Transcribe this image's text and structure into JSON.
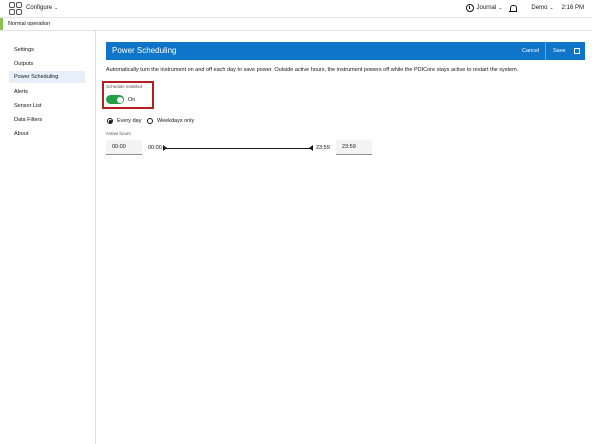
{
  "topbar": {
    "menu_label": "Configure",
    "journal_label": "Journal",
    "user_label": "Demo",
    "time": "2:16 PM"
  },
  "status": {
    "text": "Normal operation",
    "color": "#8bc34a"
  },
  "sidebar": {
    "items": [
      {
        "label": "Settings"
      },
      {
        "label": "Outputs"
      },
      {
        "label": "Power Scheduling",
        "active": true
      },
      {
        "label": "Alerts"
      },
      {
        "label": "Sensor List"
      },
      {
        "label": "Data Filters"
      },
      {
        "label": "About"
      }
    ]
  },
  "panel": {
    "title": "Power Scheduling",
    "cancel_label": "Cancel",
    "save_label": "Save",
    "header_color": "#0f75c9",
    "description": "Automatically turn the instrument on and off each day to save power. Outside active hours, the instrument powers off while the PDICore stays active to restart the system."
  },
  "schedule": {
    "toggle_label": "Schedule enabled",
    "toggle_state": "On",
    "enabled": true,
    "options": [
      {
        "label": "Every day",
        "selected": true
      },
      {
        "label": "Weekdays only",
        "selected": false
      }
    ],
    "active_hours_label": "Active hours",
    "start_value": "00:00",
    "end_value": "23:59",
    "range_min_label": "00:00",
    "range_max_label": "23:59"
  }
}
